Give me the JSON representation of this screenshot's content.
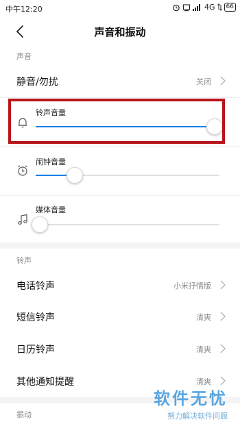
{
  "status_bar": {
    "time": "中午12:20",
    "network": "4G",
    "battery": "66"
  },
  "header": {
    "title": "声音和振动"
  },
  "sections": {
    "sound": "声音",
    "ringtone": "铃声",
    "vibration": "振动"
  },
  "rows": {
    "dnd": {
      "label": "静音/勿扰",
      "value": "关闭"
    },
    "phone_ringtone": {
      "label": "电话铃声",
      "value": "小米抒情版"
    },
    "sms_ringtone": {
      "label": "短信铃声",
      "value": "清爽"
    },
    "calendar_ringtone": {
      "label": "日历铃声",
      "value": "清爽"
    },
    "other_notifications": {
      "label": "其他通知提醒",
      "value": "清爽"
    }
  },
  "volumes": {
    "ringtone": {
      "label": "铃声音量",
      "level": 0.97
    },
    "alarm": {
      "label": "闹钟音量",
      "level": 0.21
    },
    "media": {
      "label": "媒体音量",
      "level": 0.02
    }
  },
  "colors": {
    "accent": "#1a7fe8",
    "highlight_box": "#b8141b"
  },
  "watermark": {
    "main": "软件无忧",
    "sub": "努力解决软件问题"
  }
}
